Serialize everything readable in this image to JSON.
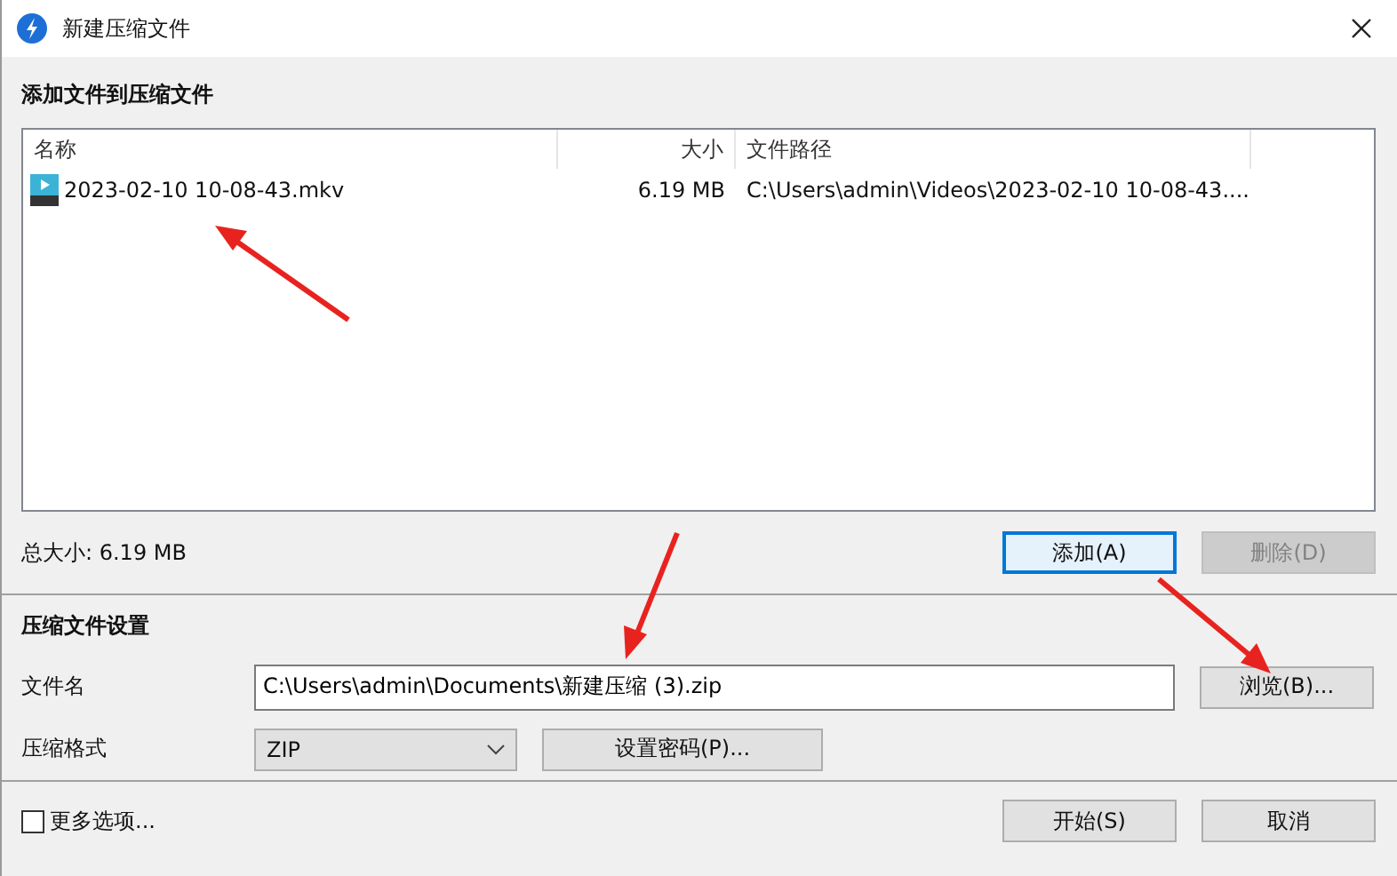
{
  "window": {
    "title": "新建压缩文件"
  },
  "files_section": {
    "title": "添加文件到压缩文件",
    "columns": [
      "名称",
      "大小",
      "文件路径"
    ],
    "rows": [
      {
        "name": "2023-02-10 10-08-43.mkv",
        "size": "6.19 MB",
        "path": "C:\\Users\\admin\\Videos\\2023-02-10 10-08-43...."
      }
    ],
    "total": "总大小: 6.19 MB",
    "buttons": [
      {
        "label": "添加(A)",
        "disabled": false,
        "focused": true
      },
      {
        "label": "删除(D)",
        "disabled": true,
        "focused": false
      }
    ]
  },
  "settings": {
    "title": "压缩文件设置",
    "filename_label": "文件名",
    "filename": "C:\\Users\\admin\\Documents\\新建压缩 (3).zip",
    "browse": "浏览(B)...",
    "format_label": "压缩格式",
    "format": "ZIP",
    "password": "设置密码(P)..."
  },
  "footer": {
    "more_options": {
      "label": "更多选项...",
      "checked": false
    },
    "buttons": [
      {
        "label": "开始(S)",
        "disabled": false
      },
      {
        "label": "取消",
        "disabled": false
      }
    ]
  }
}
